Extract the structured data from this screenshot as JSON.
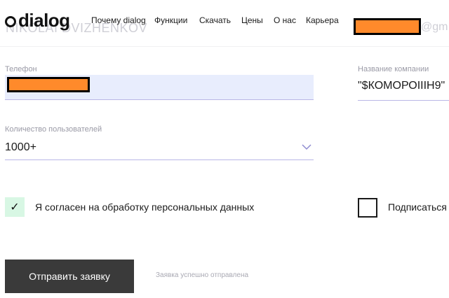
{
  "header": {
    "logo_text": "dialog",
    "nav": [
      "Почему dialog",
      "Функции",
      "Скачать",
      "Цены",
      "О нас",
      "Карьера"
    ],
    "ghost_name": "NIKOLAI DVIZHENKOV",
    "ghost_email_fragment": "@gm"
  },
  "form": {
    "phone_label": "Телефон",
    "company_label": "Название компании",
    "company_value": "\"$КОМОРОIIIН9\"",
    "users_label": "Количество пользователей",
    "users_value": "1000+",
    "consent_text": "Я согласен на обработку персональных данных",
    "subscribe_text": "Подписаться",
    "submit_label": "Отправить заявку",
    "success_text": "Заявка успешно отправлена"
  },
  "colors": {
    "phone_field_bg": "#e8edfd",
    "underline": "#b9b6e6",
    "checkbox_checked_bg": "#d8f7e4",
    "button_bg": "#3a3a3a",
    "redaction": "#ff8a2b"
  }
}
